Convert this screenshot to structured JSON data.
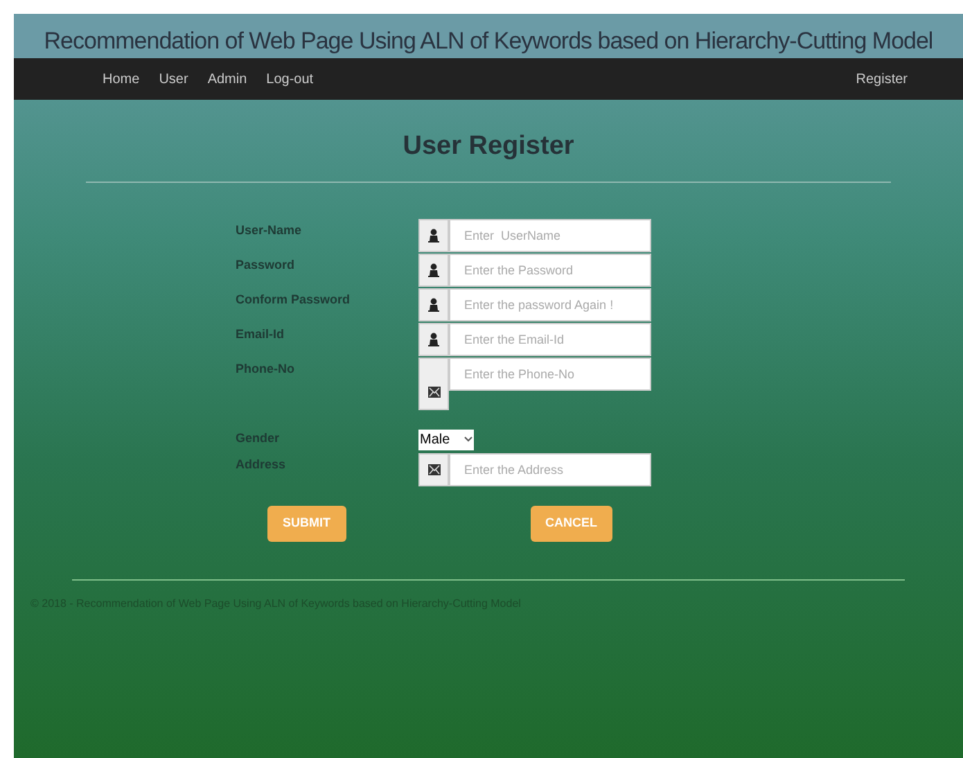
{
  "header": {
    "title": "Recommendation of Web Page Using ALN of Keywords based on Hierarchy-Cutting Model"
  },
  "nav": {
    "items": [
      "Home",
      "User",
      "Admin",
      "Log-out"
    ],
    "right_item": "Register"
  },
  "form": {
    "heading": "User Register",
    "fields": [
      {
        "label": "User-Name",
        "kind": "user",
        "placeholder": "Enter  UserName"
      },
      {
        "label": "Password",
        "kind": "user",
        "placeholder": "Enter the Password"
      },
      {
        "label": "Conform Password",
        "kind": "user",
        "placeholder": "Enter the password Again !"
      },
      {
        "label": "Email-Id",
        "kind": "user",
        "placeholder": "Enter the Email-Id"
      },
      {
        "label": "Phone-No",
        "kind": "mail-tall",
        "placeholder": "Enter the Phone-No"
      },
      {
        "label": "Gender",
        "kind": "select",
        "value": "Male"
      },
      {
        "label": "Address",
        "kind": "mail",
        "placeholder": "Enter the Address"
      }
    ],
    "buttons": [
      "SUBMIT",
      "CANCEL"
    ]
  },
  "footer": {
    "text": "© 2018 - Recommendation of Web Page Using ALN of Keywords based on Hierarchy-Cutting Model"
  }
}
